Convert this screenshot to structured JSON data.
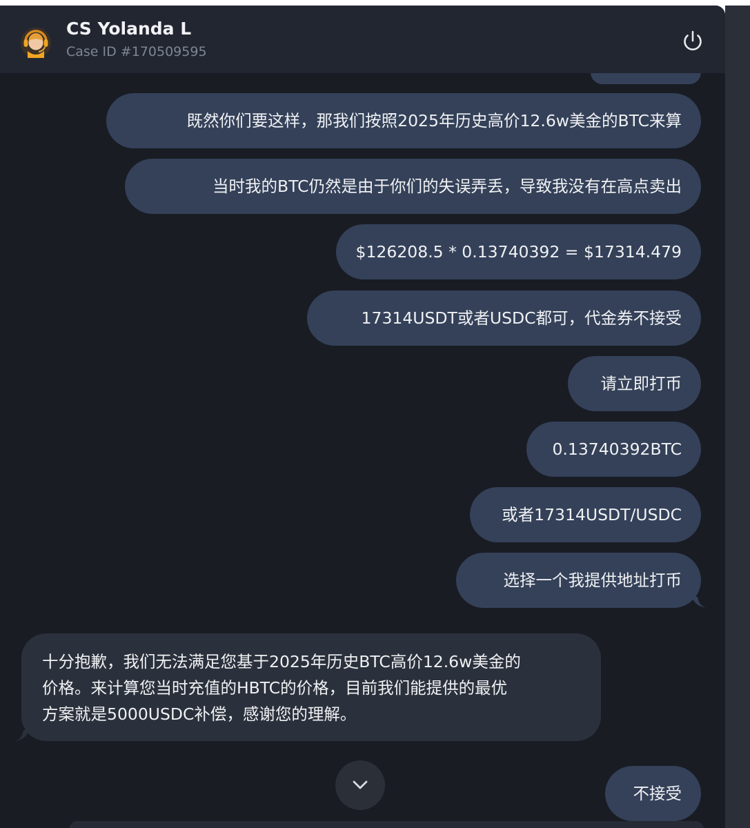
{
  "header": {
    "agent_name": "CS Yolanda L",
    "case_id": "Case ID #170509595",
    "avatar_icon": "support-agent-avatar-icon",
    "power_icon": "power-icon"
  },
  "messages": [
    {
      "side": "out",
      "text": "既然你们要这样，那我们按照2025年历史高价12.6w美金的BTC来算"
    },
    {
      "side": "out",
      "text": "当时我的BTC仍然是由于你们的失误弄丢，导致我没有在高点卖出"
    },
    {
      "side": "out",
      "text": "$126208.5 * 0.13740392 = $17314.479"
    },
    {
      "side": "out",
      "text": "17314USDT或者USDC都可，代金券不接受"
    },
    {
      "side": "out",
      "text": "请立即打币"
    },
    {
      "side": "out",
      "text": "0.13740392BTC"
    },
    {
      "side": "out",
      "text": "或者17314USDT/USDC"
    },
    {
      "side": "out",
      "text": "选择一个我提供地址打币"
    },
    {
      "side": "in",
      "lines": [
        "十分抱歉，我们无法满足您基于2025年历史BTC高价12.6w美金的",
        "价格。来计算您当时充值的HBTC的价格，目前我们能提供的最优",
        "方案就是5000USDC补偿，感谢您的理解。"
      ]
    },
    {
      "side": "out",
      "text": "不接受"
    }
  ],
  "scroll_down_icon": "chevron-down-icon",
  "colors": {
    "background": "#191c23",
    "header": "#222631",
    "outgoing_bubble": "#344159",
    "incoming_bubble": "#2b313c",
    "text": "#f0f1f3",
    "muted_text": "#7f8694"
  }
}
